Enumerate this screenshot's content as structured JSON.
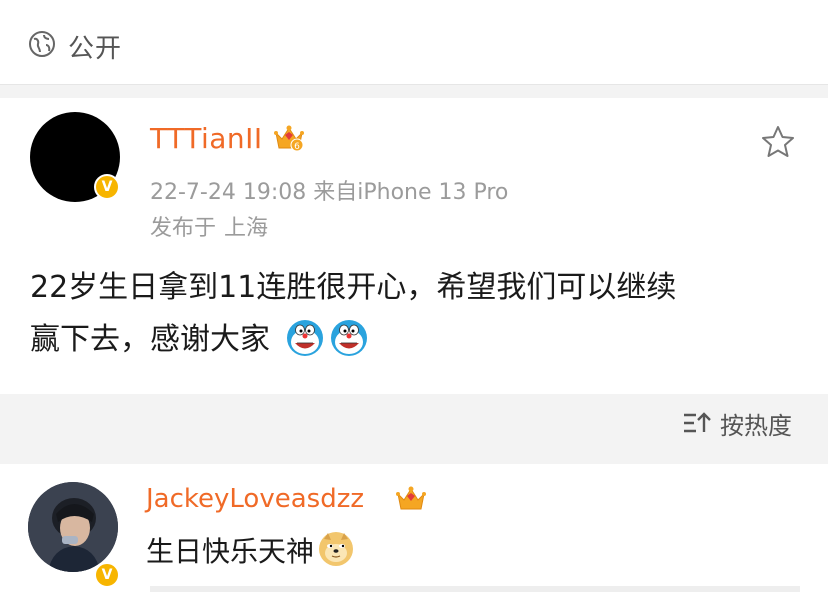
{
  "visibility": {
    "label": "公开",
    "icon": "globe-icon"
  },
  "post": {
    "username": "TTTianII",
    "timestamp": "22-7-24 19:08  来自iPhone 13 Pro",
    "location_prefix": "发布于",
    "location_city": "上海",
    "text_line1": "22岁生日拿到11连胜很开心，希望我们可以继续",
    "text_line2": "赢下去，感谢大家",
    "emojis": [
      "doraemon-emoji",
      "doraemon-emoji"
    ],
    "verified_badge": "V",
    "level_badge": "6",
    "favorite_icon": "star-icon"
  },
  "sort": {
    "label": "按热度",
    "icon": "sort-icon"
  },
  "comment": {
    "username": "JackeyLoveasdzz",
    "text": "生日快乐天神",
    "emoji": "doge-emoji",
    "verified_badge": "V"
  },
  "colors": {
    "username": "#f06a27",
    "meta": "#9b9b9b",
    "badge": "#f7b500",
    "background": "#f3f3f3"
  }
}
